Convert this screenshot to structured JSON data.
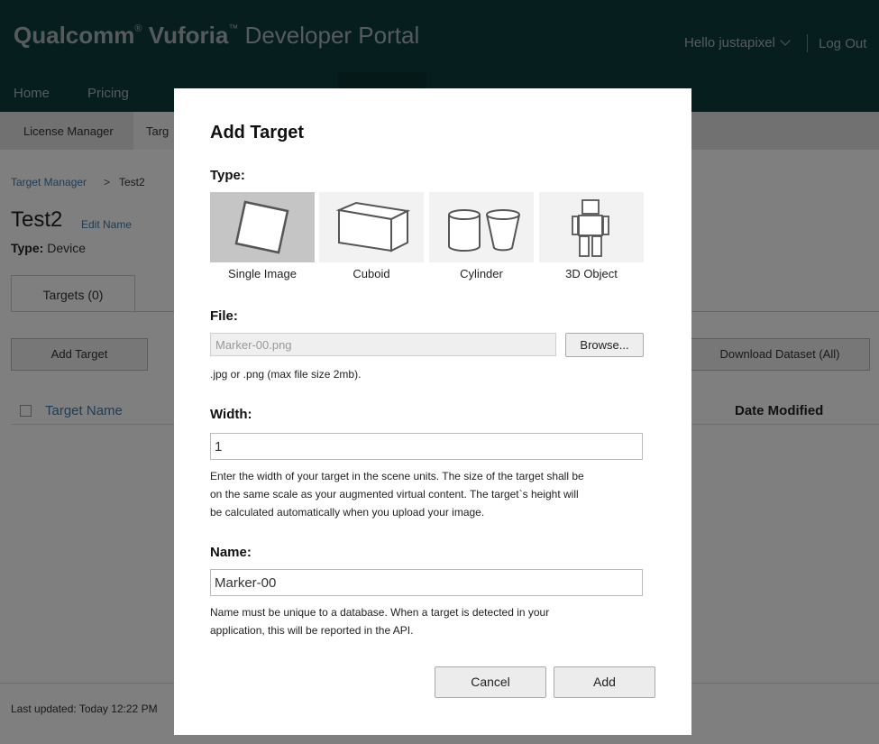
{
  "header": {
    "brand": "Qualcomm",
    "brand_mark": "®",
    "product": "Vuforia",
    "product_mark": "™",
    "portal": "Developer Portal",
    "greeting": "Hello justapixel",
    "logout": "Log Out",
    "nav": [
      "Home",
      "Pricing"
    ]
  },
  "subnav": {
    "items": [
      "License Manager",
      "Targ"
    ]
  },
  "breadcrumb": {
    "root": "Target Manager",
    "separator": ">",
    "current": "Test2"
  },
  "database": {
    "name": "Test2",
    "edit_link": "Edit Name",
    "type_label": "Type:",
    "type_value": "Device",
    "tab": "Targets (0)"
  },
  "toolbar": {
    "add_target": "Add Target",
    "download": "Download Dataset (All)"
  },
  "table": {
    "col_target": "Target Name",
    "col_date": "Date Modified"
  },
  "footer": {
    "last_updated": "Last updated: Today 12:22 PM"
  },
  "modal": {
    "title": "Add Target",
    "type_label": "Type:",
    "types": [
      {
        "label": "Single Image",
        "icon": "single-image-icon",
        "selected": true
      },
      {
        "label": "Cuboid",
        "icon": "cuboid-icon",
        "selected": false
      },
      {
        "label": "Cylinder",
        "icon": "cylinder-icon",
        "selected": false
      },
      {
        "label": "3D Object",
        "icon": "3d-object-icon",
        "selected": false
      }
    ],
    "file_label": "File:",
    "file_value": "Marker-00.png",
    "browse": "Browse...",
    "file_hint": ".jpg or .png (max file size 2mb).",
    "width_label": "Width:",
    "width_value": "1",
    "width_hint_lines": [
      "Enter the width of your target in the scene units. The size of the target shall be",
      "on the same scale as your augmented virtual content. The target`s height will",
      "be calculated automatically when you upload your image."
    ],
    "name_label": "Name:",
    "name_value": "Marker-00",
    "name_hint_lines": [
      "Name must be unique to a database. When a target is detected in your",
      "application, this will be reported in the API."
    ],
    "cancel": "Cancel",
    "add": "Add"
  },
  "colors": {
    "header_bg": "#0f3d3f",
    "selected_tile": "#c5c5c5",
    "link": "#3a7bb0"
  }
}
